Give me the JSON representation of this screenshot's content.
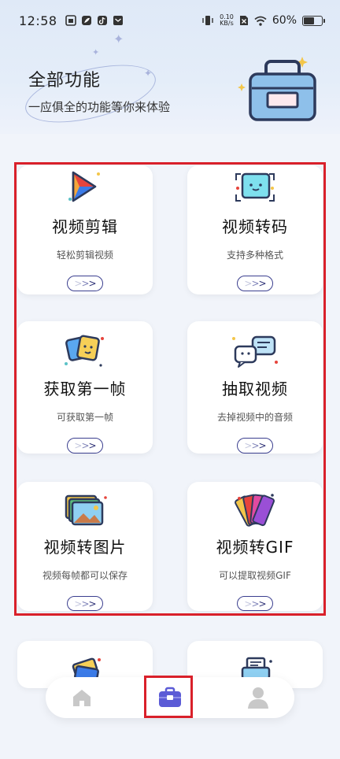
{
  "status_bar": {
    "time": "12:58",
    "net_speed_value": "0.10",
    "net_speed_unit": "KB/s",
    "battery_percent": "60%",
    "battery_level": 0.6
  },
  "hero": {
    "title": "全部功能",
    "subtitle": "一应俱全的功能等你来体验"
  },
  "cards": [
    {
      "title": "视频剪辑",
      "desc": "轻松剪辑视频",
      "icon": "play-video-icon"
    },
    {
      "title": "视频转码",
      "desc": "支持多种格式",
      "icon": "transcode-screen-icon"
    },
    {
      "title": "获取第一帧",
      "desc": "可获取第一帧",
      "icon": "frames-icon"
    },
    {
      "title": "抽取视频",
      "desc": "去掉视频中的音频",
      "icon": "chat-bubbles-icon"
    },
    {
      "title": "视频转图片",
      "desc": "视频每帧都可以保存",
      "icon": "photo-stack-icon"
    },
    {
      "title": "视频转GIF",
      "desc": "可以提取视频GIF",
      "icon": "color-cards-icon"
    }
  ],
  "bottom_nav": {
    "active": "toolbox",
    "items": [
      "home-icon",
      "toolbox-icon",
      "user-icon"
    ]
  },
  "colors": {
    "accent": "#5b5bd6",
    "highlight": "#d9202a",
    "arrow_border": "#3b3f8f"
  }
}
